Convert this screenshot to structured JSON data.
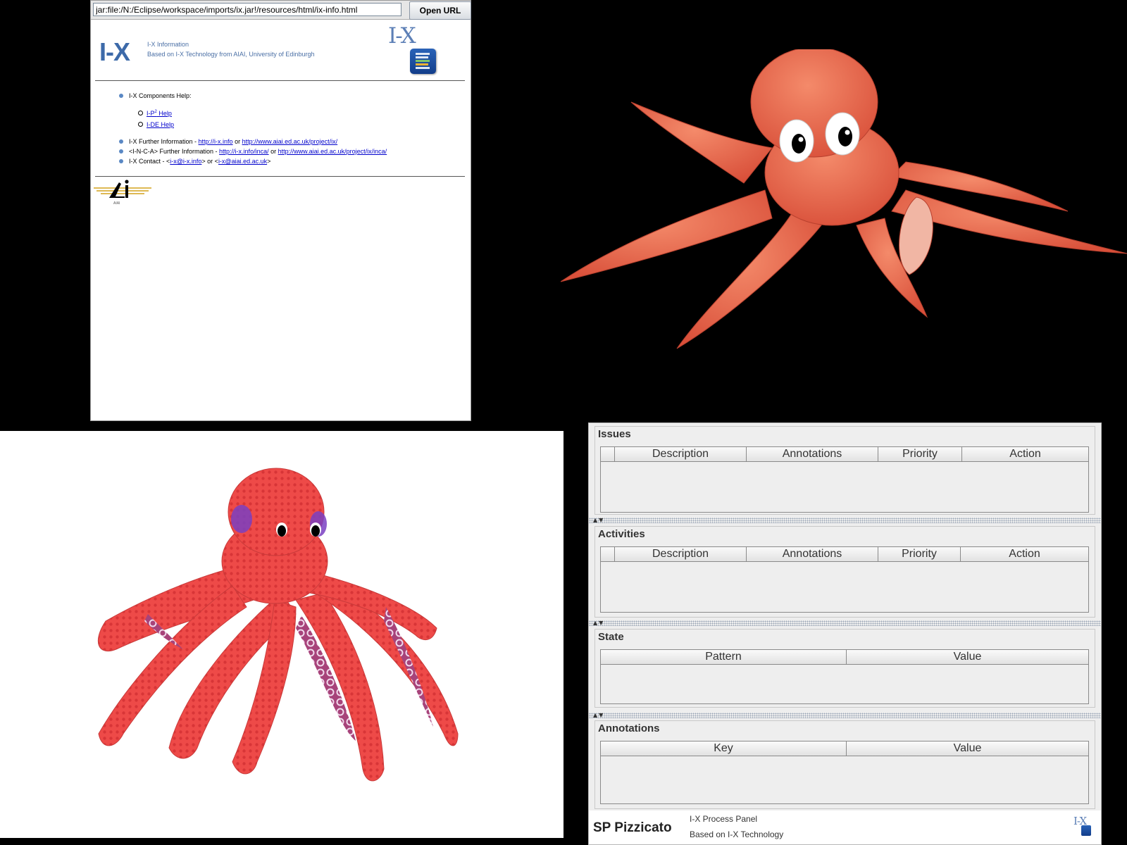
{
  "browser": {
    "url": "jar:file:/N:/Eclipse/workspace/imports/ix.jar!/resources/html/ix-info.html",
    "open_url_label": "Open URL",
    "page": {
      "logo_text": "I-X",
      "title": "I-X Information",
      "subtitle": "Based on I-X Technology from AIAI, University of Edinburgh",
      "logo_serif": "I-X",
      "components_help": "I-X Components Help:",
      "ip2_help_prefix": "I-P",
      "ip2_help_sup": "2",
      "ip2_help_suffix": " Help",
      "ide_help": "I-DE Help",
      "further_info_label": "I-X Further Information - ",
      "further_info_link1": "http://i-x.info",
      "further_info_or": " or ",
      "further_info_link2": "http://www.aiai.ed.ac.uk/project/ix/",
      "inca_label": "<I-N-C-A> Further Information - ",
      "inca_link1": "http://i-x.info/inca/",
      "inca_or": " or ",
      "inca_link2": "http://www.aiai.ed.ac.uk/project/ix/inca/",
      "contact_label": "I-X Contact - <",
      "contact_link1": "i-x@i-x.info",
      "contact_mid": "> or <",
      "contact_link2": "i-x@aiai.ed.ac.uk",
      "contact_end": ">",
      "aiai_logo_text": "AIAI"
    }
  },
  "panel": {
    "issues": {
      "title": "Issues",
      "columns": [
        "",
        "Description",
        "Annotations",
        "Priority",
        "Action"
      ]
    },
    "activities": {
      "title": "Activities",
      "columns": [
        "",
        "Description",
        "Annotations",
        "Priority",
        "Action"
      ]
    },
    "state": {
      "title": "State",
      "columns": [
        "Pattern",
        "Value"
      ]
    },
    "annotations": {
      "title": "Annotations",
      "columns": [
        "Key",
        "Value"
      ]
    },
    "footer": {
      "agent_name": "SP Pizzicato",
      "line1": "I-X Process Panel",
      "line2": "Based on I-X Technology",
      "logo": "I-X"
    }
  },
  "colors": {
    "octopus_top": "#e8604a",
    "octopus_bottom": "#ee4444",
    "ix_blue": "#3d6aa9",
    "panel_bg": "#eeeeee"
  }
}
